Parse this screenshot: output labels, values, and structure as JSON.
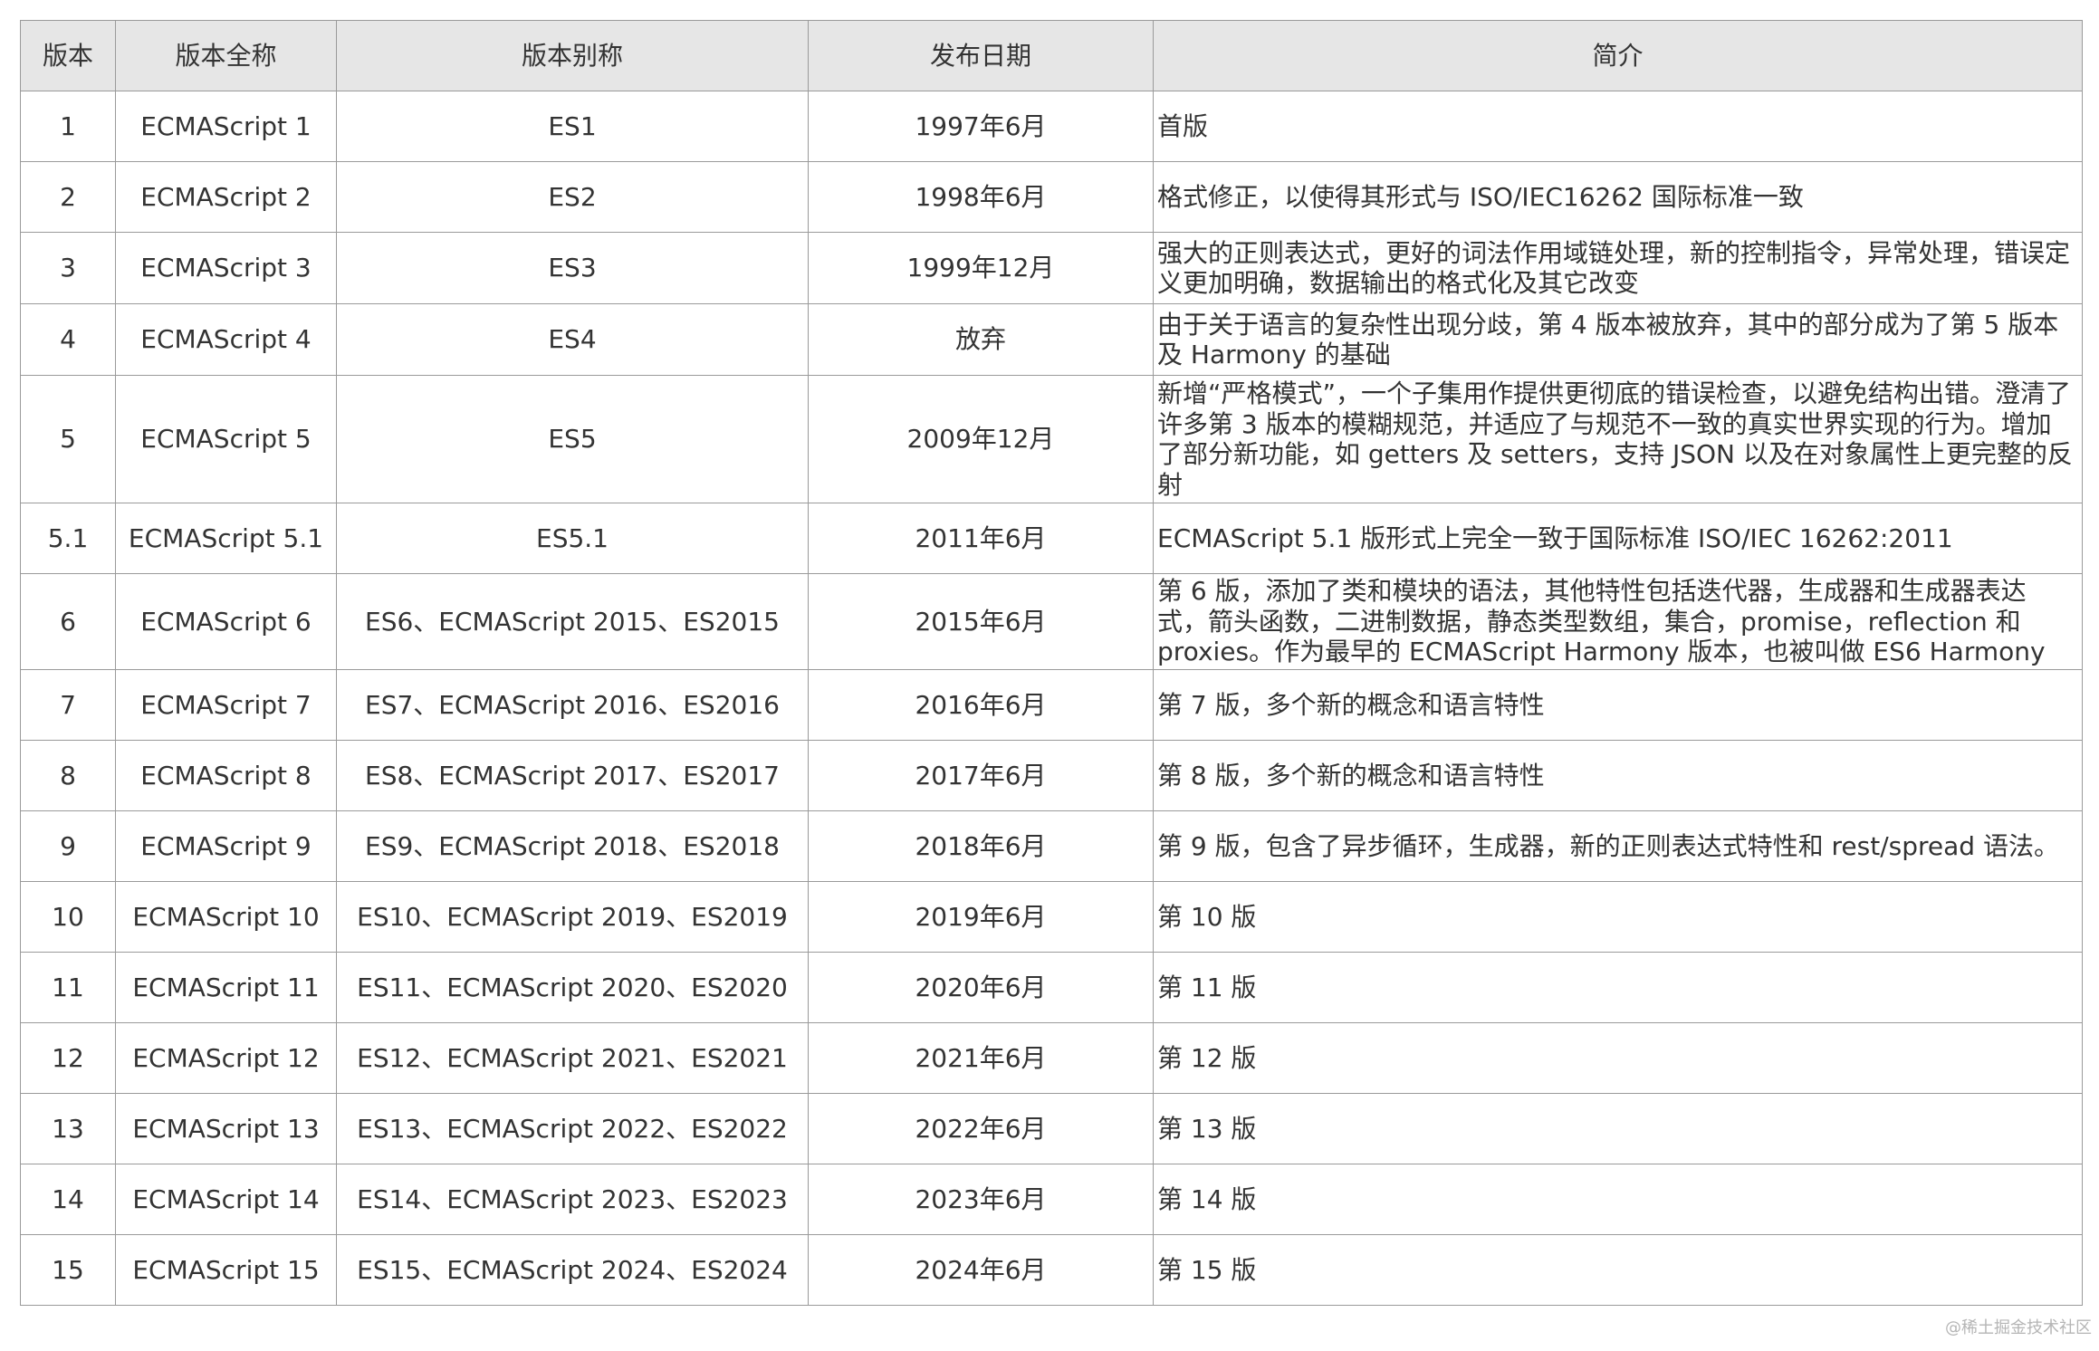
{
  "table": {
    "headers": [
      "版本",
      "版本全称",
      "版本别称",
      "发布日期",
      "简介"
    ],
    "rows": [
      {
        "version": "1",
        "full_name": "ECMAScript 1",
        "alias": "ES1",
        "date": "1997年6月",
        "summary": "首版"
      },
      {
        "version": "2",
        "full_name": "ECMAScript 2",
        "alias": "ES2",
        "date": "1998年6月",
        "summary": "格式修正，以使得其形式与 ISO/IEC16262 国际标准一致"
      },
      {
        "version": "3",
        "full_name": "ECMAScript 3",
        "alias": "ES3",
        "date": "1999年12月",
        "summary": "强大的正则表达式，更好的词法作用域链处理，新的控制指令，异常处理，错误定义更加明确，数据输出的格式化及其它改变"
      },
      {
        "version": "4",
        "full_name": "ECMAScript 4",
        "alias": "ES4",
        "date": "放弃",
        "summary": "由于关于语言的复杂性出现分歧，第 4 版本被放弃，其中的部分成为了第 5 版本及 Harmony 的基础"
      },
      {
        "version": "5",
        "full_name": "ECMAScript 5",
        "alias": "ES5",
        "date": "2009年12月",
        "summary": "新增“严格模式”，一个子集用作提供更彻底的错误检查，以避免结构出错。澄清了许多第 3 版本的模糊规范，并适应了与规范不一致的真实世界实现的行为。增加了部分新功能，如 getters 及 setters，支持 JSON 以及在对象属性上更完整的反射"
      },
      {
        "version": "5.1",
        "full_name": "ECMAScript 5.1",
        "alias": "ES5.1",
        "date": "2011年6月",
        "summary": " ECMAScript  5.1 版形式上完全一致于国际标准 ISO/IEC 16262:2011"
      },
      {
        "version": "6",
        "full_name": "ECMAScript 6",
        "alias": "ES6、ECMAScript 2015、ES2015",
        "date": "2015年6月",
        "summary": "第 6 版，添加了类和模块的语法，其他特性包括迭代器，生成器和生成器表达式，箭头函数，二进制数据，静态类型数组，集合，promise，reflection 和 proxies。作为最早的 ECMAScript Harmony 版本，也被叫做 ES6 Harmony"
      },
      {
        "version": "7",
        "full_name": "ECMAScript 7",
        "alias": "ES7、ECMAScript 2016、ES2016",
        "date": "2016年6月",
        "summary": " 第 7 版，多个新的概念和语言特性"
      },
      {
        "version": "8",
        "full_name": "ECMAScript 8",
        "alias": "ES8、ECMAScript 2017、ES2017",
        "date": "2017年6月",
        "summary": " 第 8 版，多个新的概念和语言特性"
      },
      {
        "version": "9",
        "full_name": "ECMAScript 9",
        "alias": "ES9、ECMAScript 2018、ES2018",
        "date": "2018年6月",
        "summary": " 第 9 版，包含了异步循环，生成器，新的正则表达式特性和 rest/spread 语法。"
      },
      {
        "version": "10",
        "full_name": "ECMAScript 10",
        "alias": "ES10、ECMAScript 2019、ES2019",
        "date": "2019年6月",
        "summary": " 第 10 版"
      },
      {
        "version": "11",
        "full_name": "ECMAScript 11",
        "alias": "ES11、ECMAScript 2020、ES2020",
        "date": "2020年6月",
        "summary": " 第 11 版"
      },
      {
        "version": "12",
        "full_name": "ECMAScript 12",
        "alias": "ES12、ECMAScript 2021、ES2021",
        "date": "2021年6月",
        "summary": " 第 12 版"
      },
      {
        "version": "13",
        "full_name": "ECMAScript 13",
        "alias": "ES13、ECMAScript 2022、ES2022",
        "date": "2022年6月",
        "summary": " 第 13 版"
      },
      {
        "version": "14",
        "full_name": "ECMAScript 14",
        "alias": "ES14、ECMAScript 2023、ES2023",
        "date": "2023年6月",
        "summary": " 第 14 版"
      },
      {
        "version": "15",
        "full_name": "ECMAScript 15",
        "alias": "ES15、ECMAScript 2024、ES2024",
        "date": "2024年6月",
        "summary": " 第 15 版"
      }
    ]
  },
  "watermark": "@稀土掘金技术社区",
  "colors": {
    "header_bg": "#e6e6e6",
    "border": "#9a9a9a",
    "text": "#333333"
  }
}
